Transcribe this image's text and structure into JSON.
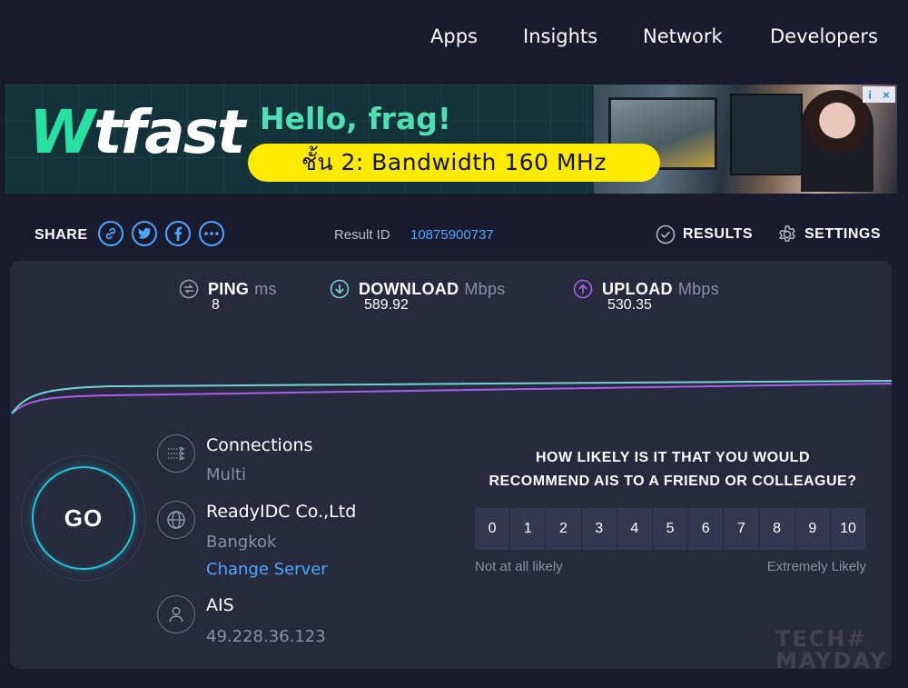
{
  "nav": {
    "items": [
      "Apps",
      "Insights",
      "Network",
      "Developers"
    ]
  },
  "ad": {
    "logo_mark": "W",
    "logo_text": "tfast",
    "tagline": "Hello, frag!",
    "adchoices_i": "i",
    "adchoices_x": "×"
  },
  "overlay_badge": "ชั้น 2: Bandwidth 160 MHz",
  "share": {
    "label": "SHARE"
  },
  "result": {
    "label": "Result ID",
    "id": "10875900737"
  },
  "actions": {
    "results": "RESULTS",
    "settings": "SETTINGS"
  },
  "metrics": {
    "ping": {
      "label": "PING",
      "unit": "ms",
      "value": "8"
    },
    "download": {
      "label": "DOWNLOAD",
      "unit": "Mbps",
      "value": "589.92"
    },
    "upload": {
      "label": "UPLOAD",
      "unit": "Mbps",
      "value": "530.35"
    }
  },
  "colors": {
    "download_line": "#6fd6d8",
    "upload_line": "#a463e8",
    "accent_blue": "#4da6ff",
    "go_ring": "#1ec7d8"
  },
  "go": {
    "label": "GO"
  },
  "connection": {
    "title": "Connections",
    "value": "Multi"
  },
  "server": {
    "title": "ReadyIDC Co.,Ltd",
    "location": "Bangkok",
    "change_link": "Change Server"
  },
  "isp": {
    "title": "AIS",
    "ip": "49.228.36.123"
  },
  "survey": {
    "question_line1": "HOW LIKELY IS IT THAT YOU WOULD",
    "question_line2": "RECOMMEND AIS TO A FRIEND OR COLLEAGUE?",
    "scale": [
      "0",
      "1",
      "2",
      "3",
      "4",
      "5",
      "6",
      "7",
      "8",
      "9",
      "10"
    ],
    "low_label": "Not at all likely",
    "high_label": "Extremely Likely"
  },
  "watermark": {
    "line1": "TECH#",
    "line2": "MAYDAY"
  }
}
